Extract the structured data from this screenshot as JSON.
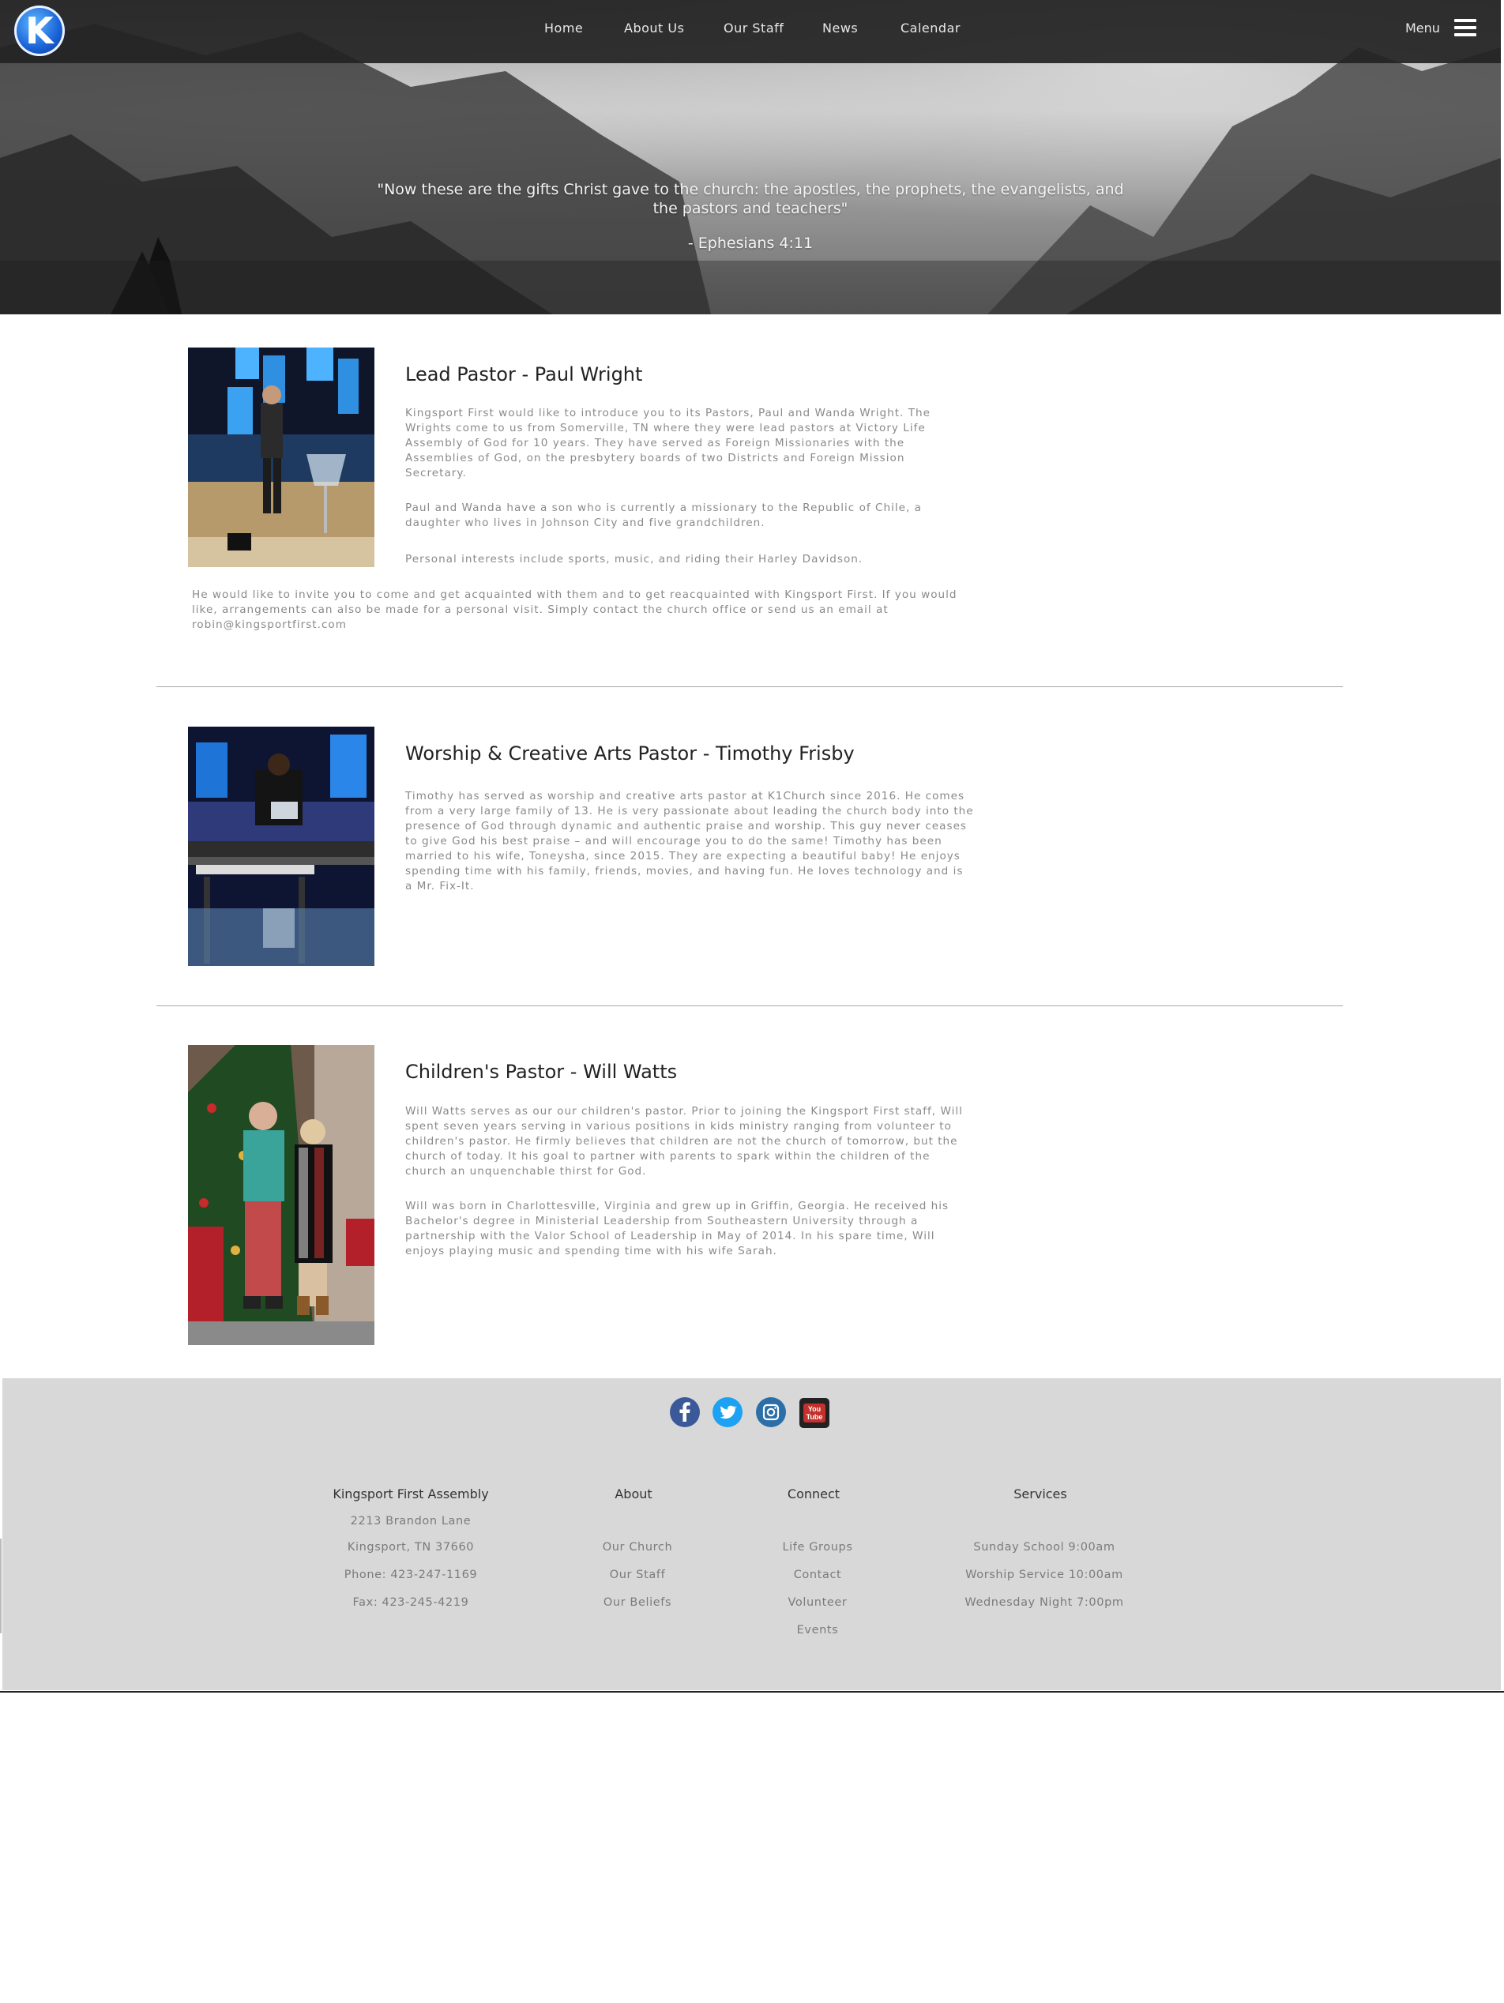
{
  "header": {
    "logo_letter": "K",
    "nav": [
      "Home",
      "About Us",
      "Our Staff",
      "News",
      "Calendar"
    ],
    "menu_label": "Menu"
  },
  "hero": {
    "quote": "\"Now these are the gifts Christ gave to the church: the apostles, the prophets, the evangelists, and the pastors and teachers\"",
    "reference": "- Ephesians 4:11"
  },
  "staff": [
    {
      "title": "Lead Pastor - Paul Wright",
      "paragraphs": [
        "Kingsport First would like to introduce you to its Pastors, Paul and Wanda Wright. The Wrights come to us from Somerville, TN where they were lead pastors at Victory Life Assembly of God for 10 years. They have served as Foreign Missionaries with the Assemblies of God, on the presbytery boards of two Districts and Foreign Mission Secretary.",
        "Paul and Wanda have a son who is currently a missionary to the Republic of Chile, a daughter who lives in Johnson City and five grandchildren.",
        "Personal interests include sports, music, and riding their Harley Davidson."
      ],
      "extra": "He would like to invite you to come and get acquainted with them and to get reacquainted with Kingsport First. If you would like, arrangements can also be made for a personal visit. Simply contact the church office or send us an email at robin@kingsportfirst.com"
    },
    {
      "title": "Worship & Creative Arts Pastor - Timothy Frisby",
      "paragraphs": [
        "Timothy has served as worship and creative arts pastor at K1Church since 2016. He comes from a very large family of 13. He is very passionate about leading the church body into the presence of God through dynamic and authentic praise and worship. This guy never ceases to give God his best praise – and will encourage you to do the same! Timothy has been married to his wife, Toneysha, since 2015. They are expecting a beautiful baby! He enjoys spending time with his family, friends, movies, and having fun. He loves technology and is a Mr. Fix-It."
      ]
    },
    {
      "title": "Children's Pastor - Will Watts",
      "paragraphs": [
        "Will Watts serves as our our children's pastor. Prior to joining the Kingsport First staff, Will spent seven years serving in various positions in kids ministry ranging from volunteer to children's pastor. He firmly believes that children are not the church of tomorrow, but the church of today. It his goal to partner with parents to spark within the children of the church an unquenchable thirst for God.",
        "Will was born in Charlottesville, Virginia and grew up in Griffin, Georgia. He received his Bachelor's degree in Ministerial Leadership from Southeastern University through a partnership with the Valor School of Leadership in May of 2014. In his spare time, Will enjoys playing music and spending time with his wife Sarah."
      ]
    }
  ],
  "footer": {
    "social_icons": [
      "facebook-icon",
      "twitter-icon",
      "instagram-icon",
      "youtube-icon"
    ],
    "youtube_text": "You Tube",
    "col_church": {
      "heading": "Kingsport First Assembly",
      "lines": [
        "2213 Brandon Lane",
        "Kingsport, TN 37660",
        "Phone: 423-247-1169",
        "Fax: 423-245-4219"
      ]
    },
    "col_about": {
      "heading": "About",
      "links": [
        "Our Church",
        "Our Staff",
        "Our Beliefs"
      ]
    },
    "col_connect": {
      "heading": "Connect",
      "links": [
        "Life Groups",
        "Contact",
        "Volunteer",
        "Events"
      ]
    },
    "col_services": {
      "heading": "Services",
      "lines": [
        "Sunday School 9:00am",
        "Worship Service 10:00am",
        "Wednesday Night 7:00pm"
      ]
    }
  },
  "colors": {
    "topbar": "#232323",
    "footer": "#d8d8d8",
    "facebook": "#3b5998",
    "twitter": "#1da1f2",
    "instagram": "#2b6ea8",
    "youtube": "#222222"
  }
}
